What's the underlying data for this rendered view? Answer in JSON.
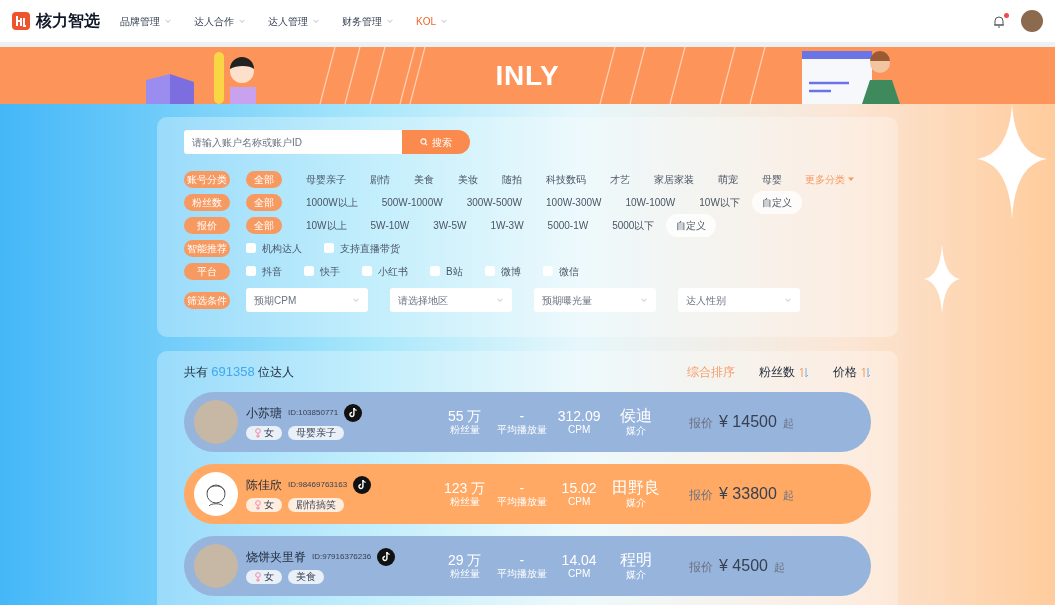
{
  "header": {
    "brand": "核力智选",
    "nav": [
      {
        "label": "品牌管理",
        "selected": false
      },
      {
        "label": "达人合作",
        "selected": false
      },
      {
        "label": "达人管理",
        "selected": false
      },
      {
        "label": "财务管理",
        "selected": false
      },
      {
        "label": "KOL",
        "selected": true
      }
    ],
    "notification_dot": true
  },
  "banner": {
    "logo": "INLY"
  },
  "search": {
    "placeholder": "请输入账户名称或账户ID",
    "button": "搜索"
  },
  "filters": [
    {
      "kind": "options",
      "label": "账号分类",
      "options": [
        {
          "label": "全部",
          "selected": true
        },
        {
          "label": "母婴亲子",
          "selected": false
        },
        {
          "label": "剧情",
          "selected": false
        },
        {
          "label": "美食",
          "selected": false
        },
        {
          "label": "美妆",
          "selected": false
        },
        {
          "label": "随拍",
          "selected": false
        },
        {
          "label": "科技数码",
          "selected": false
        },
        {
          "label": "才艺",
          "selected": false
        },
        {
          "label": "家居家装",
          "selected": false
        },
        {
          "label": "萌宠",
          "selected": false
        },
        {
          "label": "母婴",
          "selected": false
        }
      ],
      "more": "更多分类"
    },
    {
      "kind": "options",
      "label": "粉丝数",
      "options": [
        {
          "label": "全部",
          "selected": true
        },
        {
          "label": "1000W以上",
          "selected": false
        },
        {
          "label": "500W-1000W",
          "selected": false
        },
        {
          "label": "300W-500W",
          "selected": false
        },
        {
          "label": "100W-300W",
          "selected": false
        },
        {
          "label": "10W-100W",
          "selected": false
        },
        {
          "label": "10W以下",
          "selected": false
        }
      ],
      "custom": "自定义"
    },
    {
      "kind": "options",
      "label": "报价",
      "options": [
        {
          "label": "全部",
          "selected": true
        },
        {
          "label": "10W以上",
          "selected": false
        },
        {
          "label": "5W-10W",
          "selected": false
        },
        {
          "label": "3W-5W",
          "selected": false
        },
        {
          "label": "1W-3W",
          "selected": false
        },
        {
          "label": "5000-1W",
          "selected": false
        },
        {
          "label": "5000以下",
          "selected": false
        }
      ],
      "custom": "自定义"
    },
    {
      "kind": "checks",
      "label": "智能推荐",
      "options": [
        {
          "label": "机构达人",
          "checked": false
        },
        {
          "label": "支持直播带货",
          "checked": false
        }
      ]
    },
    {
      "kind": "checks",
      "label": "平台",
      "options": [
        {
          "label": "抖音",
          "checked": false
        },
        {
          "label": "快手",
          "checked": false
        },
        {
          "label": "小红书",
          "checked": false
        },
        {
          "label": "B站",
          "checked": false
        },
        {
          "label": "微博",
          "checked": false
        },
        {
          "label": "微信",
          "checked": false
        }
      ]
    },
    {
      "kind": "selects",
      "label": "筛选条件",
      "options": [
        {
          "placeholder": "预期CPM"
        },
        {
          "placeholder": "请选择地区"
        },
        {
          "placeholder": "预期曝光量"
        },
        {
          "placeholder": "达人性别"
        }
      ]
    }
  ],
  "results": {
    "prefix": "共有",
    "count": "691358",
    "suffix": "位达人",
    "sorts": [
      {
        "label": "综合排序",
        "selected": true,
        "sortable": false
      },
      {
        "label": "粉丝数",
        "selected": false,
        "sortable": true
      },
      {
        "label": "价格",
        "selected": false,
        "sortable": true
      }
    ]
  },
  "kols": [
    {
      "name": "小苏瑭",
      "id": "ID:103850771",
      "gender": "女",
      "tag": "母婴亲子",
      "fans": "55 万",
      "fans_label": "粉丝量",
      "plays": "-",
      "plays_label": "平均播放量",
      "cpm": "312.09",
      "cpm_label": "CPM",
      "agent": "侯迪",
      "agent_label": "媒介",
      "price_label": "报价",
      "price": "¥ 14500",
      "price_suffix": "起",
      "highlighted": false,
      "kind": "photo"
    },
    {
      "name": "陈佳欣",
      "id": "ID:98469763163",
      "gender": "女",
      "tag": "剧情搞笑",
      "fans": "123 万",
      "fans_label": "粉丝量",
      "plays": "-",
      "plays_label": "平均播放量",
      "cpm": "15.02",
      "cpm_label": "CPM",
      "agent": "田野良",
      "agent_label": "媒介",
      "price_label": "报价",
      "price": "¥ 33800",
      "price_suffix": "起",
      "highlighted": true,
      "kind": "sketch"
    },
    {
      "name": "烧饼夹里脊",
      "id": "ID:97916376236",
      "gender": "女",
      "tag": "美食",
      "fans": "29 万",
      "fans_label": "粉丝量",
      "plays": "-",
      "plays_label": "平均播放量",
      "cpm": "14.04",
      "cpm_label": "CPM",
      "agent": "程明",
      "agent_label": "媒介",
      "price_label": "报价",
      "price": "¥ 4500",
      "price_suffix": "起",
      "highlighted": false,
      "kind": "photo"
    }
  ]
}
